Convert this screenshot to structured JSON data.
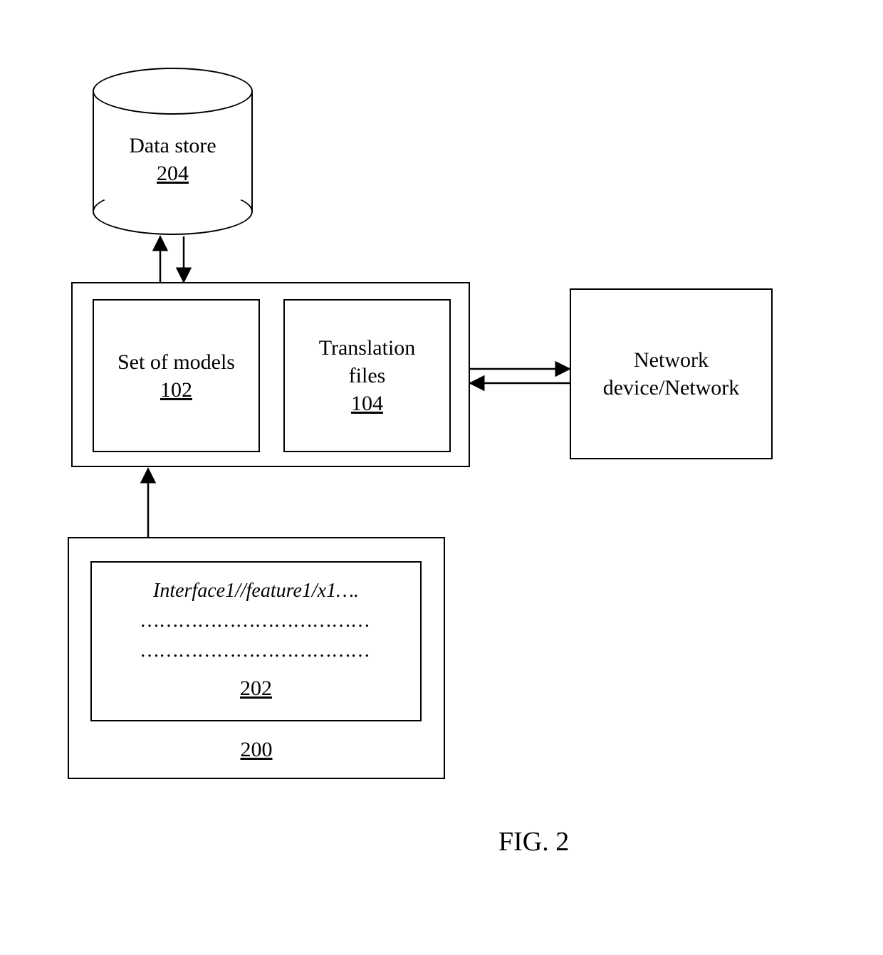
{
  "datastore": {
    "label": "Data store",
    "ref": "204"
  },
  "container": {
    "models": {
      "label": "Set of models",
      "ref": "102"
    },
    "translation": {
      "label1": "Translation",
      "label2": "files",
      "ref": "104"
    }
  },
  "network": {
    "label1": "Network",
    "label2": "device/Network"
  },
  "lower": {
    "inner": {
      "line1": "Interface1//feature1/x1….",
      "line2": "………………………………",
      "line3": "………………………………",
      "ref": "202"
    },
    "ref": "200"
  },
  "figure": "FIG. 2"
}
